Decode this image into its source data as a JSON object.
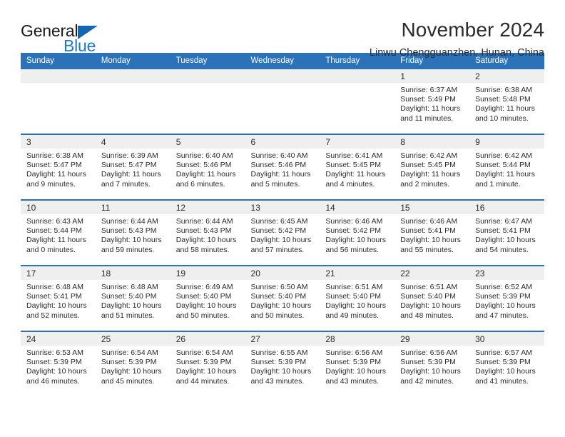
{
  "brand": {
    "name_part1": "General",
    "name_part2": "Blue"
  },
  "header": {
    "title": "November 2024",
    "subtitle": "Linwu Chengguanzhen, Hunan, China"
  },
  "weekdays": [
    "Sunday",
    "Monday",
    "Tuesday",
    "Wednesday",
    "Thursday",
    "Friday",
    "Saturday"
  ],
  "labels": {
    "sunrise_prefix": "Sunrise:",
    "sunset_prefix": "Sunset:",
    "daylight_prefix": "Daylight:"
  },
  "colors": {
    "header_blue": "#2c72b8",
    "brand_blue": "#1f77c4",
    "daynum_bg": "#efefef"
  },
  "weeks": [
    [
      {
        "empty": true
      },
      {
        "empty": true
      },
      {
        "empty": true
      },
      {
        "empty": true
      },
      {
        "empty": true
      },
      {
        "day": "1",
        "sunrise": "Sunrise: 6:37 AM",
        "sunset": "Sunset: 5:49 PM",
        "daylight": "Daylight: 11 hours and 11 minutes."
      },
      {
        "day": "2",
        "sunrise": "Sunrise: 6:38 AM",
        "sunset": "Sunset: 5:48 PM",
        "daylight": "Daylight: 11 hours and 10 minutes."
      }
    ],
    [
      {
        "day": "3",
        "sunrise": "Sunrise: 6:38 AM",
        "sunset": "Sunset: 5:47 PM",
        "daylight": "Daylight: 11 hours and 9 minutes."
      },
      {
        "day": "4",
        "sunrise": "Sunrise: 6:39 AM",
        "sunset": "Sunset: 5:47 PM",
        "daylight": "Daylight: 11 hours and 7 minutes."
      },
      {
        "day": "5",
        "sunrise": "Sunrise: 6:40 AM",
        "sunset": "Sunset: 5:46 PM",
        "daylight": "Daylight: 11 hours and 6 minutes."
      },
      {
        "day": "6",
        "sunrise": "Sunrise: 6:40 AM",
        "sunset": "Sunset: 5:46 PM",
        "daylight": "Daylight: 11 hours and 5 minutes."
      },
      {
        "day": "7",
        "sunrise": "Sunrise: 6:41 AM",
        "sunset": "Sunset: 5:45 PM",
        "daylight": "Daylight: 11 hours and 4 minutes."
      },
      {
        "day": "8",
        "sunrise": "Sunrise: 6:42 AM",
        "sunset": "Sunset: 5:45 PM",
        "daylight": "Daylight: 11 hours and 2 minutes."
      },
      {
        "day": "9",
        "sunrise": "Sunrise: 6:42 AM",
        "sunset": "Sunset: 5:44 PM",
        "daylight": "Daylight: 11 hours and 1 minute."
      }
    ],
    [
      {
        "day": "10",
        "sunrise": "Sunrise: 6:43 AM",
        "sunset": "Sunset: 5:44 PM",
        "daylight": "Daylight: 11 hours and 0 minutes."
      },
      {
        "day": "11",
        "sunrise": "Sunrise: 6:44 AM",
        "sunset": "Sunset: 5:43 PM",
        "daylight": "Daylight: 10 hours and 59 minutes."
      },
      {
        "day": "12",
        "sunrise": "Sunrise: 6:44 AM",
        "sunset": "Sunset: 5:43 PM",
        "daylight": "Daylight: 10 hours and 58 minutes."
      },
      {
        "day": "13",
        "sunrise": "Sunrise: 6:45 AM",
        "sunset": "Sunset: 5:42 PM",
        "daylight": "Daylight: 10 hours and 57 minutes."
      },
      {
        "day": "14",
        "sunrise": "Sunrise: 6:46 AM",
        "sunset": "Sunset: 5:42 PM",
        "daylight": "Daylight: 10 hours and 56 minutes."
      },
      {
        "day": "15",
        "sunrise": "Sunrise: 6:46 AM",
        "sunset": "Sunset: 5:41 PM",
        "daylight": "Daylight: 10 hours and 55 minutes."
      },
      {
        "day": "16",
        "sunrise": "Sunrise: 6:47 AM",
        "sunset": "Sunset: 5:41 PM",
        "daylight": "Daylight: 10 hours and 54 minutes."
      }
    ],
    [
      {
        "day": "17",
        "sunrise": "Sunrise: 6:48 AM",
        "sunset": "Sunset: 5:41 PM",
        "daylight": "Daylight: 10 hours and 52 minutes."
      },
      {
        "day": "18",
        "sunrise": "Sunrise: 6:48 AM",
        "sunset": "Sunset: 5:40 PM",
        "daylight": "Daylight: 10 hours and 51 minutes."
      },
      {
        "day": "19",
        "sunrise": "Sunrise: 6:49 AM",
        "sunset": "Sunset: 5:40 PM",
        "daylight": "Daylight: 10 hours and 50 minutes."
      },
      {
        "day": "20",
        "sunrise": "Sunrise: 6:50 AM",
        "sunset": "Sunset: 5:40 PM",
        "daylight": "Daylight: 10 hours and 50 minutes."
      },
      {
        "day": "21",
        "sunrise": "Sunrise: 6:51 AM",
        "sunset": "Sunset: 5:40 PM",
        "daylight": "Daylight: 10 hours and 49 minutes."
      },
      {
        "day": "22",
        "sunrise": "Sunrise: 6:51 AM",
        "sunset": "Sunset: 5:40 PM",
        "daylight": "Daylight: 10 hours and 48 minutes."
      },
      {
        "day": "23",
        "sunrise": "Sunrise: 6:52 AM",
        "sunset": "Sunset: 5:39 PM",
        "daylight": "Daylight: 10 hours and 47 minutes."
      }
    ],
    [
      {
        "day": "24",
        "sunrise": "Sunrise: 6:53 AM",
        "sunset": "Sunset: 5:39 PM",
        "daylight": "Daylight: 10 hours and 46 minutes."
      },
      {
        "day": "25",
        "sunrise": "Sunrise: 6:54 AM",
        "sunset": "Sunset: 5:39 PM",
        "daylight": "Daylight: 10 hours and 45 minutes."
      },
      {
        "day": "26",
        "sunrise": "Sunrise: 6:54 AM",
        "sunset": "Sunset: 5:39 PM",
        "daylight": "Daylight: 10 hours and 44 minutes."
      },
      {
        "day": "27",
        "sunrise": "Sunrise: 6:55 AM",
        "sunset": "Sunset: 5:39 PM",
        "daylight": "Daylight: 10 hours and 43 minutes."
      },
      {
        "day": "28",
        "sunrise": "Sunrise: 6:56 AM",
        "sunset": "Sunset: 5:39 PM",
        "daylight": "Daylight: 10 hours and 43 minutes."
      },
      {
        "day": "29",
        "sunrise": "Sunrise: 6:56 AM",
        "sunset": "Sunset: 5:39 PM",
        "daylight": "Daylight: 10 hours and 42 minutes."
      },
      {
        "day": "30",
        "sunrise": "Sunrise: 6:57 AM",
        "sunset": "Sunset: 5:39 PM",
        "daylight": "Daylight: 10 hours and 41 minutes."
      }
    ]
  ]
}
